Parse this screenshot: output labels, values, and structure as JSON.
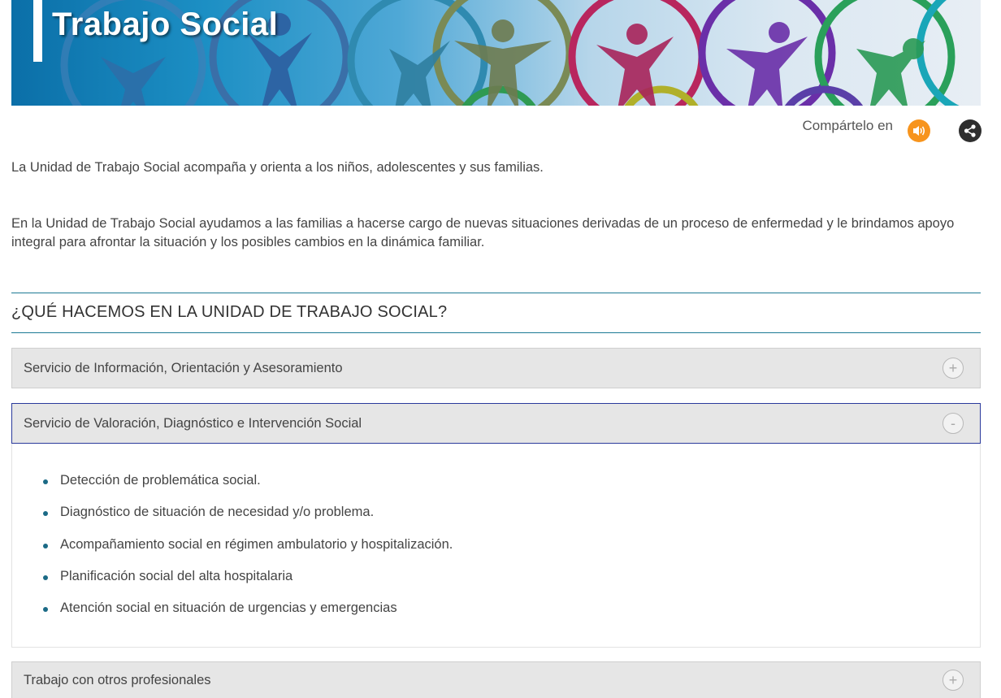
{
  "banner": {
    "title": "Trabajo Social"
  },
  "share": {
    "label": "Compártelo en",
    "audio_icon": "speaker-icon",
    "share_icon": "share-icon",
    "audio_color": "#f7941d",
    "share_color": "#2e2e2e"
  },
  "intro": {
    "text": "La Unidad de Trabajo Social acompaña y orienta a los niños, adolescentes y sus familias.",
    "paragraph2": "En la  Unidad de Trabajo Social ayudamos a las familias a hacerse cargo de nuevas situaciones derivadas de un proceso de enfermedad y le brindamos apoyo integral para afrontar la situación y los posibles cambios en la dinámica familiar."
  },
  "section": {
    "heading": "¿QUÉ HACEMOS EN LA UNIDAD DE TRABAJO SOCIAL?"
  },
  "accordion": [
    {
      "title": "Servicio de Información, Orientación y Asesoramiento",
      "toggle": "+",
      "expanded": false
    },
    {
      "title": "Servicio de Valoración, Diagnóstico e Intervención Social",
      "toggle": "-",
      "expanded": true,
      "items": [
        "Detección de problemática social.",
        "Diagnóstico de situación de necesidad y/o problema.",
        "Acompañamiento social en régimen ambulatorio y hospitalización.",
        "Planificación social del alta hospitalaria",
        "Atención social en situación de urgencias y emergencias"
      ]
    },
    {
      "title": "Trabajo con otros profesionales",
      "toggle": "+",
      "expanded": false
    }
  ],
  "colors": {
    "accent_line": "#1c7a94",
    "open_border": "#2a3a9c",
    "bullet": "#1b6a86",
    "accordion_bg": "#e6e6e6"
  }
}
